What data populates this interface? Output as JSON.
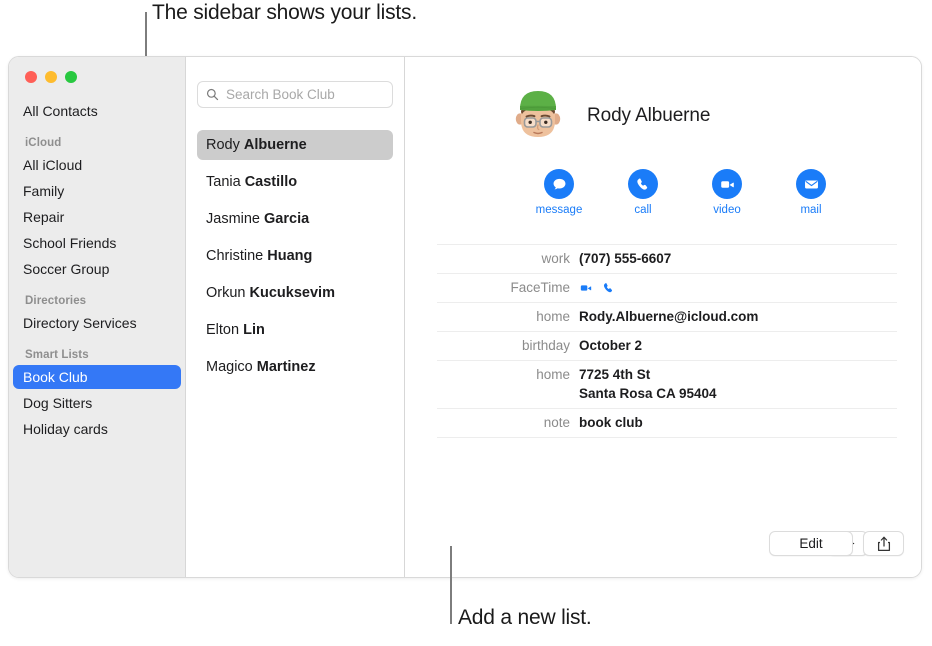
{
  "annotations": {
    "top": "The sidebar shows your lists.",
    "bottom": "Add a new list."
  },
  "colors": {
    "accent_blue": "#3478f6",
    "action_blue": "#1a7cf8",
    "sidebar_bg": "#ececec",
    "selected_row_gray": "#cccccc",
    "traffic_red": "#ff5f57",
    "traffic_yellow": "#febc2e",
    "traffic_green": "#28c840",
    "beanie_green": "#5cb046"
  },
  "window_controls": {
    "close": "close-button",
    "minimize": "minimize-button",
    "maximize": "maximize-button"
  },
  "sidebar": {
    "top_items": [
      {
        "label": "All Contacts",
        "selected": false
      }
    ],
    "groups": [
      {
        "header": "iCloud",
        "items": [
          {
            "label": "All iCloud",
            "selected": false
          },
          {
            "label": "Family",
            "selected": false
          },
          {
            "label": "Repair",
            "selected": false
          },
          {
            "label": "School Friends",
            "selected": false
          },
          {
            "label": "Soccer Group",
            "selected": false
          }
        ]
      },
      {
        "header": "Directories",
        "items": [
          {
            "label": "Directory Services",
            "selected": false
          }
        ]
      },
      {
        "header": "Smart Lists",
        "items": [
          {
            "label": "Book Club",
            "selected": true
          },
          {
            "label": "Dog Sitters",
            "selected": false
          },
          {
            "label": "Holiday cards",
            "selected": false
          }
        ]
      }
    ]
  },
  "search": {
    "placeholder": "Search Book Club",
    "value": "",
    "icon": "search-icon"
  },
  "contact_list": [
    {
      "first": "Rody",
      "last": "Albuerne",
      "selected": true
    },
    {
      "first": "Tania",
      "last": "Castillo",
      "selected": false
    },
    {
      "first": "Jasmine",
      "last": "Garcia",
      "selected": false
    },
    {
      "first": "Christine",
      "last": "Huang",
      "selected": false
    },
    {
      "first": "Orkun",
      "last": "Kucuksevim",
      "selected": false
    },
    {
      "first": "Elton",
      "last": "Lin",
      "selected": false
    },
    {
      "first": "Magico",
      "last": "Martinez",
      "selected": false
    }
  ],
  "detail": {
    "name": "Rody Albuerne",
    "avatar": "memoji-avatar",
    "actions": [
      {
        "label": "message",
        "icon": "message-bubble-icon"
      },
      {
        "label": "call",
        "icon": "phone-icon"
      },
      {
        "label": "video",
        "icon": "video-camera-icon"
      },
      {
        "label": "mail",
        "icon": "envelope-icon"
      }
    ],
    "fields": [
      {
        "label": "work",
        "value": "(707) 555-6607",
        "type": "text"
      },
      {
        "label": "FaceTime",
        "value": "",
        "type": "icons",
        "icons": [
          "facetime-video-icon",
          "facetime-audio-icon"
        ]
      },
      {
        "label": "home",
        "value": "Rody.Albuerne@icloud.com",
        "type": "text"
      },
      {
        "label": "birthday",
        "value": "October 2",
        "type": "text"
      },
      {
        "label": "home",
        "value": "7725 4th St\nSanta Rosa CA 95404",
        "type": "text"
      },
      {
        "label": "note",
        "value": "book club",
        "type": "text"
      }
    ]
  },
  "bottom_bar": {
    "add_label": "+",
    "add_icon": "plus-icon",
    "edit_label": "Edit",
    "share_icon": "share-icon"
  }
}
